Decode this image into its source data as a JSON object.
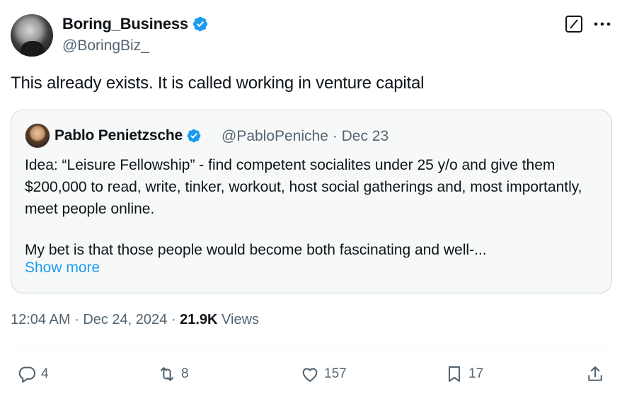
{
  "tweet": {
    "author": {
      "name": "Boring_Business",
      "handle": "@BoringBiz_"
    },
    "text": "This already exists. It is called working in venture capital",
    "header_icons": {
      "grok": "grok-icon",
      "more": "more-icon"
    }
  },
  "quoted_tweet": {
    "author": {
      "name": "Pablo Penietzsche",
      "handle": "@PabloPeniche"
    },
    "separator": "·",
    "date": "Dec 23",
    "paragraphs": [
      "Idea: “Leisure Fellowship” - find competent socialites under 25 y/o and give them $200,000 to read, write, tinker, workout, host social gatherings and, most importantly, meet people online.",
      "My bet is that those people would become both fascinating and well-..."
    ],
    "show_more": "Show more"
  },
  "meta": {
    "time": "12:04 AM",
    "separator": "·",
    "date": "Dec 24, 2024",
    "views_count": "21.9K",
    "views_label": "Views"
  },
  "actions": {
    "replies": "4",
    "reposts": "8",
    "likes": "157",
    "bookmarks": "17"
  },
  "colors": {
    "accent": "#1d9bf0",
    "text": "#0f1419",
    "muted": "#536471",
    "quote_bg": "#f7f9f9",
    "border": "#cfd9de"
  }
}
